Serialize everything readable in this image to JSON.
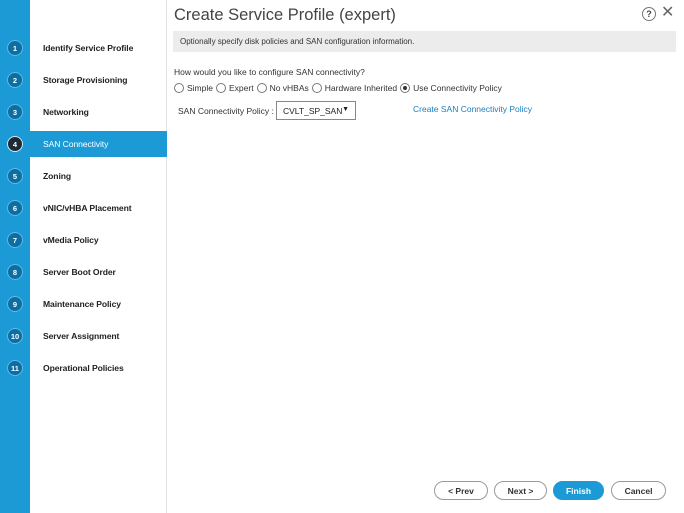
{
  "dialog": {
    "title": "Create Service Profile (expert)",
    "help_label": "?",
    "close_label": "✕",
    "banner": "Optionally specify disk policies and SAN configuration information."
  },
  "steps": [
    {
      "num": "1",
      "label": "Identify Service Profile"
    },
    {
      "num": "2",
      "label": "Storage Provisioning"
    },
    {
      "num": "3",
      "label": "Networking"
    },
    {
      "num": "4",
      "label": "SAN Connectivity",
      "active": true
    },
    {
      "num": "5",
      "label": "Zoning"
    },
    {
      "num": "6",
      "label": "vNIC/vHBA Placement"
    },
    {
      "num": "7",
      "label": "vMedia Policy"
    },
    {
      "num": "8",
      "label": "Server Boot Order"
    },
    {
      "num": "9",
      "label": "Maintenance Policy"
    },
    {
      "num": "10",
      "label": "Server Assignment"
    },
    {
      "num": "11",
      "label": "Operational Policies"
    }
  ],
  "san": {
    "question": "How would you like to configure SAN connectivity?",
    "options": [
      {
        "label": "Simple",
        "selected": false
      },
      {
        "label": "Expert",
        "selected": false
      },
      {
        "label": "No vHBAs",
        "selected": false
      },
      {
        "label": "Hardware Inherited",
        "selected": false
      },
      {
        "label": "Use Connectivity Policy",
        "selected": true
      }
    ],
    "policy_label": "SAN Connectivity Policy :",
    "policy_value": "CVLT_SP_SAN",
    "create_link": "Create SAN Connectivity Policy"
  },
  "buttons": {
    "prev": "< Prev",
    "next": "Next >",
    "finish": "Finish",
    "cancel": "Cancel"
  },
  "colors": {
    "accent": "#1b9ad6",
    "step_circle": "#0c6ea3",
    "active_circle": "#1d2a36",
    "link": "#1b7fbf"
  }
}
